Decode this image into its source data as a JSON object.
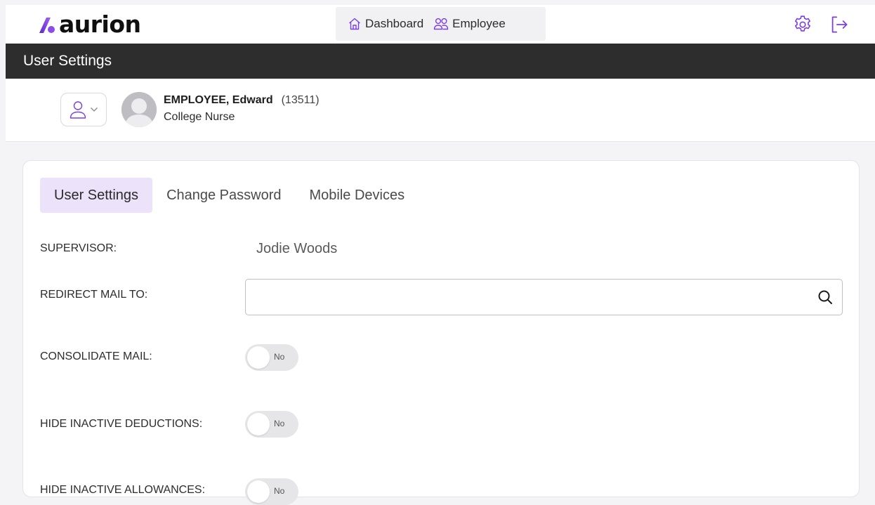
{
  "brand": {
    "name": "aurion",
    "accent": "#7b3fe4",
    "accent_light": "#ece3fb"
  },
  "nav": {
    "dashboard_label": "Dashboard",
    "employee_label": "Employee"
  },
  "page": {
    "title": "User Settings"
  },
  "employee": {
    "name": "EMPLOYEE, Edward",
    "id": "(13511)",
    "role": "College Nurse"
  },
  "tabs": [
    {
      "label": "User Settings",
      "active": true
    },
    {
      "label": "Change Password",
      "active": false
    },
    {
      "label": "Mobile Devices",
      "active": false
    }
  ],
  "form": {
    "supervisor_label": "SUPERVISOR:",
    "supervisor_value": "Jodie Woods",
    "redirect_label": "REDIRECT MAIL TO:",
    "redirect_value": "",
    "consolidate_label": "CONSOLIDATE MAIL:",
    "consolidate_value": "No",
    "hide_deductions_label": "HIDE INACTIVE DEDUCTIONS:",
    "hide_deductions_value": "No",
    "hide_allowances_label": "HIDE INACTIVE ALLOWANCES:",
    "hide_allowances_value": "No"
  },
  "icons": {
    "dashboard": "home-icon",
    "employee": "users-icon",
    "settings": "gear-icon",
    "logout": "logout-icon",
    "person": "user-icon",
    "chevron": "chevron-down-icon",
    "search": "search-icon"
  }
}
